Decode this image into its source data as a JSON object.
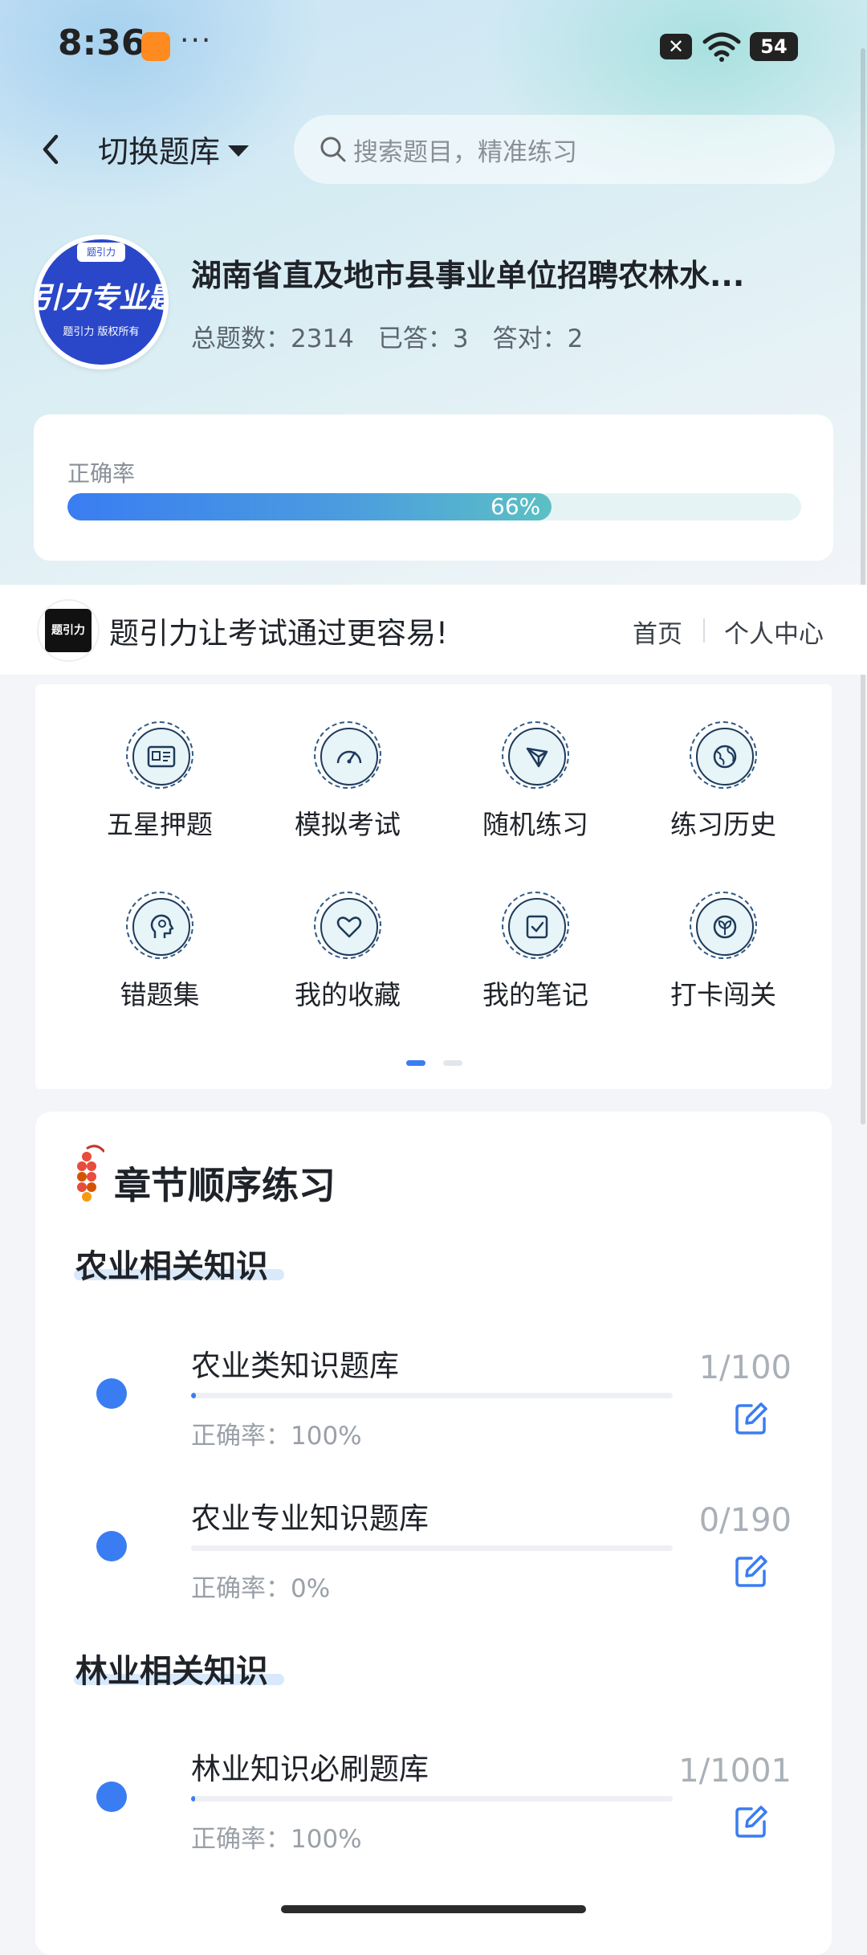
{
  "status_bar": {
    "time": "8:36",
    "dots": "···",
    "battery": "54",
    "x_label": "✕"
  },
  "header": {
    "back_label": "返回",
    "switch_label": "切换题库",
    "search_placeholder": "搜索题目，精准练习"
  },
  "bank": {
    "logo_tag": "题引力",
    "logo_text": "引力专业题",
    "logo_sub": "题引力 版权所有",
    "title": "湖南省直及地市县事业单位招聘农林水...",
    "stats": {
      "total": "总题数：2314",
      "answered": "已答：3",
      "correct": "答对：2"
    }
  },
  "accuracy": {
    "label": "正确率",
    "value": 0.66,
    "text": "66%"
  },
  "slogan": {
    "logo_text": "题引力",
    "text": "题引力让考试通过更容易!",
    "home": "首页",
    "me": "个人中心"
  },
  "functions": [
    {
      "label": "五星押题",
      "icon": "id-card-icon"
    },
    {
      "label": "模拟考试",
      "icon": "speedometer-icon"
    },
    {
      "label": "随机练习",
      "icon": "network-icon"
    },
    {
      "label": "练习历史",
      "icon": "globe-icon"
    },
    {
      "label": "错题集",
      "icon": "head-icon"
    },
    {
      "label": "我的收藏",
      "icon": "heart-icon"
    },
    {
      "label": "我的笔记",
      "icon": "note-check-icon"
    },
    {
      "label": "打卡闯关",
      "icon": "leaf-icon"
    }
  ],
  "chapter": {
    "title": "章节顺序练习",
    "sections": [
      {
        "title": "农业相关知识",
        "rows": [
          {
            "name": "农业类知识题库",
            "accuracy": "正确率：100%",
            "count": "1/100",
            "progress": 0.01
          },
          {
            "name": "农业专业知识题库",
            "accuracy": "正确率：0%",
            "count": "0/190",
            "progress": 0
          }
        ]
      },
      {
        "title": "林业相关知识",
        "rows": [
          {
            "name": "林业知识必刷题库",
            "accuracy": "正确率：100%",
            "count": "1/1001",
            "progress": 0.001
          }
        ]
      }
    ]
  },
  "colors": {
    "accent": "#3a7df2",
    "icon_stroke": "#1e3a5a",
    "teal": "#5cc0c4"
  }
}
